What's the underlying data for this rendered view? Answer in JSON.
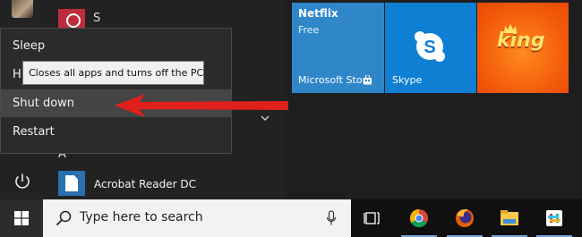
{
  "power_menu": {
    "items": [
      "Sleep",
      "H",
      "Shut down",
      "Restart"
    ],
    "highlighted": "Shut down"
  },
  "tooltip": {
    "text": "Closes all apps and turns off the PC."
  },
  "app_list": {
    "partial_label": "S",
    "section_letter": "A",
    "apps": [
      {
        "label": "Acrobat Reader DC",
        "icon": "acrobat-reader-icon"
      }
    ]
  },
  "tiles": {
    "netflix": {
      "title": "Netflix",
      "subtitle": "Free"
    },
    "store": {
      "label": "Microsoft Store"
    },
    "skype": {
      "label": "Skype"
    },
    "king": {
      "label": "King",
      "logo_text": "king"
    }
  },
  "taskbar": {
    "search_placeholder": "Type here to search",
    "apps": [
      "task-view-icon",
      "chrome-icon",
      "firefox-icon",
      "file-explorer-icon",
      "slack-icon"
    ]
  },
  "colors": {
    "accent_red": "#e0201b",
    "netflix_tile": "#2f86c9",
    "skype_tile": "#0f7fd3",
    "king_tile": "#f25a0a",
    "taskbar": "#101010"
  }
}
